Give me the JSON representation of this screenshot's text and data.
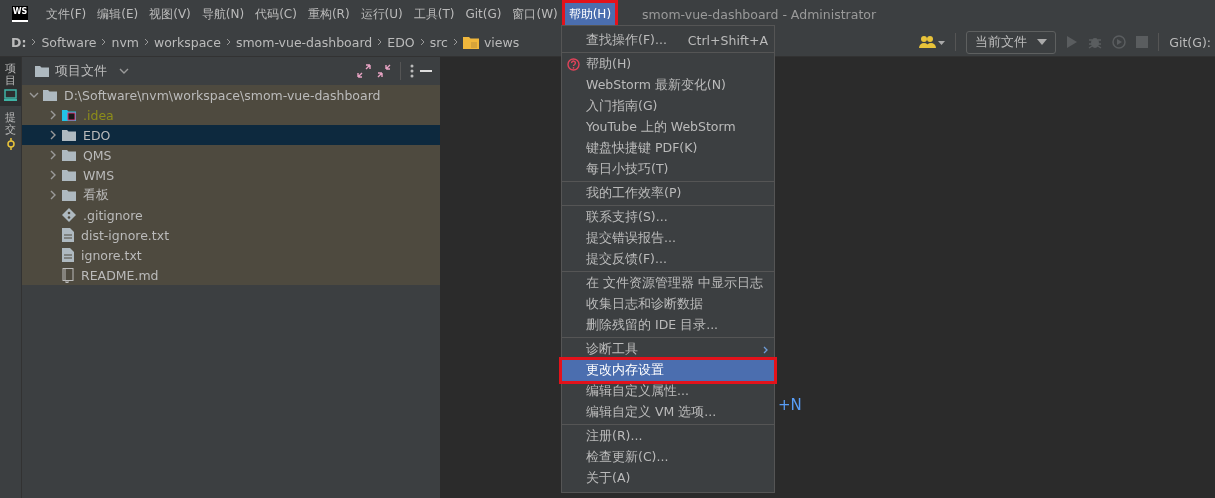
{
  "window": {
    "app_logo": "WS",
    "title": "smom-vue-dashboard - Administrator"
  },
  "menubar": [
    {
      "label": "文件(F)",
      "selected": false
    },
    {
      "label": "编辑(E)",
      "selected": false
    },
    {
      "label": "视图(V)",
      "selected": false
    },
    {
      "label": "导航(N)",
      "selected": false
    },
    {
      "label": "代码(C)",
      "selected": false
    },
    {
      "label": "重构(R)",
      "selected": false
    },
    {
      "label": "运行(U)",
      "selected": false
    },
    {
      "label": "工具(T)",
      "selected": false
    },
    {
      "label": "Git(G)",
      "selected": false
    },
    {
      "label": "窗口(W)",
      "selected": false
    },
    {
      "label": "帮助(H)",
      "selected": true
    }
  ],
  "breadcrumbs": [
    {
      "label": "D:",
      "kind": "drive"
    },
    {
      "label": "Software",
      "kind": "dir"
    },
    {
      "label": "nvm",
      "kind": "dir"
    },
    {
      "label": "workspace",
      "kind": "dir"
    },
    {
      "label": "smom-vue-dashboard",
      "kind": "dir"
    },
    {
      "label": "EDO",
      "kind": "dir"
    },
    {
      "label": "src",
      "kind": "dir"
    },
    {
      "label": "views",
      "kind": "folder"
    }
  ],
  "toolbar": {
    "run_config": "当前文件",
    "git_label": "Git(G):"
  },
  "tool_strip": [
    {
      "label": "项目",
      "kind": "project",
      "selected": true
    },
    {
      "label": "提交",
      "kind": "commit",
      "selected": false
    }
  ],
  "project_panel": {
    "title": "项目文件",
    "tree": [
      {
        "name": "D:\\Software\\nvm\\workspace\\smom-vue-dashboard",
        "kind": "folder",
        "expanded": true,
        "selected": false,
        "ignored": false,
        "children": [
          {
            "name": ".idea",
            "kind": "idea-folder",
            "expanded": false,
            "selected": false,
            "ignored": true
          },
          {
            "name": "EDO",
            "kind": "folder",
            "expanded": false,
            "selected": true,
            "ignored": false
          },
          {
            "name": "QMS",
            "kind": "folder",
            "expanded": false,
            "selected": false,
            "ignored": false
          },
          {
            "name": "WMS",
            "kind": "folder",
            "expanded": false,
            "selected": false,
            "ignored": false
          },
          {
            "name": "看板",
            "kind": "folder",
            "expanded": false,
            "selected": false,
            "ignored": false
          },
          {
            "name": ".gitignore",
            "kind": "git",
            "selected": false,
            "ignored": false
          },
          {
            "name": "dist-ignore.txt",
            "kind": "text",
            "selected": false,
            "ignored": false
          },
          {
            "name": "ignore.txt",
            "kind": "text",
            "selected": false,
            "ignored": false
          },
          {
            "name": "README.md",
            "kind": "readme",
            "selected": false,
            "ignored": false
          }
        ]
      }
    ]
  },
  "editor": {
    "hint": "+N"
  },
  "help_menu": [
    [
      {
        "label": "查找操作(F)...",
        "shortcut": "Ctrl+Shift+A",
        "kind": "action",
        "selected": false
      }
    ],
    [
      {
        "label": "帮助(H)",
        "kind": "help",
        "selected": false
      },
      {
        "label": "WebStorm 最新变化(N)",
        "kind": "action",
        "selected": false
      },
      {
        "label": "入门指南(G)",
        "kind": "action",
        "selected": false
      },
      {
        "label": "YouTube 上的 WebStorm",
        "kind": "action",
        "selected": false
      },
      {
        "label": "键盘快捷键 PDF(K)",
        "kind": "action",
        "selected": false
      },
      {
        "label": "每日小技巧(T)",
        "kind": "action",
        "selected": false
      }
    ],
    [
      {
        "label": "我的工作效率(P)",
        "kind": "action",
        "selected": false
      }
    ],
    [
      {
        "label": "联系支持(S)...",
        "kind": "action",
        "selected": false
      },
      {
        "label": "提交错误报告...",
        "kind": "action",
        "selected": false
      },
      {
        "label": "提交反馈(F)...",
        "kind": "action",
        "selected": false
      }
    ],
    [
      {
        "label": "在 文件资源管理器 中显示日志",
        "kind": "action",
        "selected": false
      },
      {
        "label": "收集日志和诊断数据",
        "kind": "action",
        "selected": false
      },
      {
        "label": "删除残留的 IDE 目录...",
        "kind": "action",
        "selected": false
      }
    ],
    [
      {
        "label": "诊断工具",
        "kind": "submenu",
        "selected": false
      },
      {
        "label": "更改内存设置",
        "kind": "action",
        "selected": true
      },
      {
        "label": "编辑自定义属性...",
        "kind": "action",
        "selected": false
      },
      {
        "label": "编辑自定义 VM 选项...",
        "kind": "action",
        "selected": false
      }
    ],
    [
      {
        "label": "注册(R)...",
        "kind": "action",
        "selected": false
      },
      {
        "label": "检查更新(C)...",
        "kind": "action",
        "selected": false
      },
      {
        "label": "关于(A)",
        "kind": "action",
        "selected": false
      }
    ]
  ]
}
